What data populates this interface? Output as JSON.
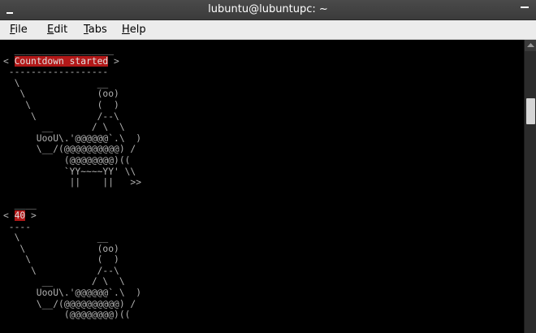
{
  "window": {
    "title": "lubuntu@lubuntupc: ~"
  },
  "menu": {
    "file_first": "F",
    "file_rest": "ile",
    "edit_first": "E",
    "edit_rest": "dit",
    "tabs_first": "T",
    "tabs_rest": "abs",
    "help_first": "H",
    "help_rest": "elp"
  },
  "terminal": {
    "block1": {
      "bubble_top": "  __________________",
      "bubble_left": "< ",
      "message": "Countdown started",
      "bubble_right": " >",
      "bubble_bottom": " ------------------",
      "cow": "  \\              __\n   \\             (oo)\n    \\            (  )\n     \\           /--\\\n       __       / \\  \\\n      UooU\\.'@@@@@@`.\\  )\n      \\__/(@@@@@@@@@@) /\n           (@@@@@@@@)((\n           `YY~~~~YY' \\\\\n            ||    ||   >>"
    },
    "block2": {
      "bubble_top": "  ____",
      "bubble_left": "< ",
      "message": "40",
      "bubble_right": " >",
      "bubble_bottom": " ----",
      "cow": "  \\              __\n   \\             (oo)\n    \\            (  )\n     \\           /--\\\n       __       / \\  \\\n      UooU\\.'@@@@@@`.\\  )\n      \\__/(@@@@@@@@@@) /\n           (@@@@@@@@)(("
    }
  },
  "colors": {
    "highlight": "#b21818",
    "terminal_fg": "#b2b2b2",
    "terminal_bg": "#000000"
  }
}
